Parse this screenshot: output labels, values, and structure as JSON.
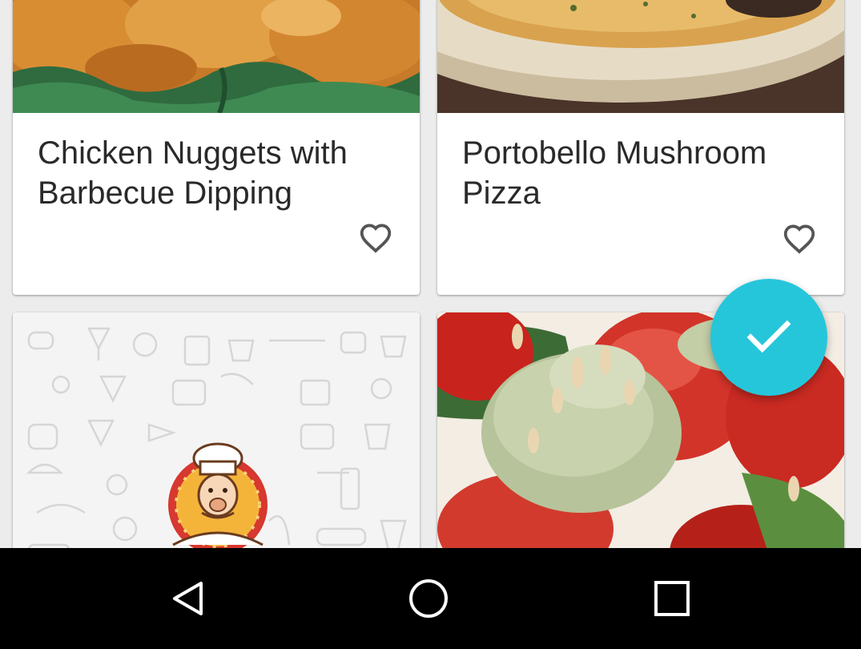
{
  "recipes": [
    {
      "title": "Chicken Nuggets with Barbecue Dipping",
      "favorite_icon": "heart-outline-icon"
    },
    {
      "title": "Portobello Mushroom Pizza",
      "favorite_icon": "heart-outline-icon"
    },
    {
      "title": "",
      "image": "chef-placeholder"
    },
    {
      "title": "",
      "image": "stuffed-tomatoes"
    }
  ],
  "fab": {
    "icon": "check-icon",
    "color": "#26c6da"
  },
  "navbar": {
    "back_icon": "back-triangle-icon",
    "home_icon": "home-circle-icon",
    "recents_icon": "recents-square-icon"
  }
}
